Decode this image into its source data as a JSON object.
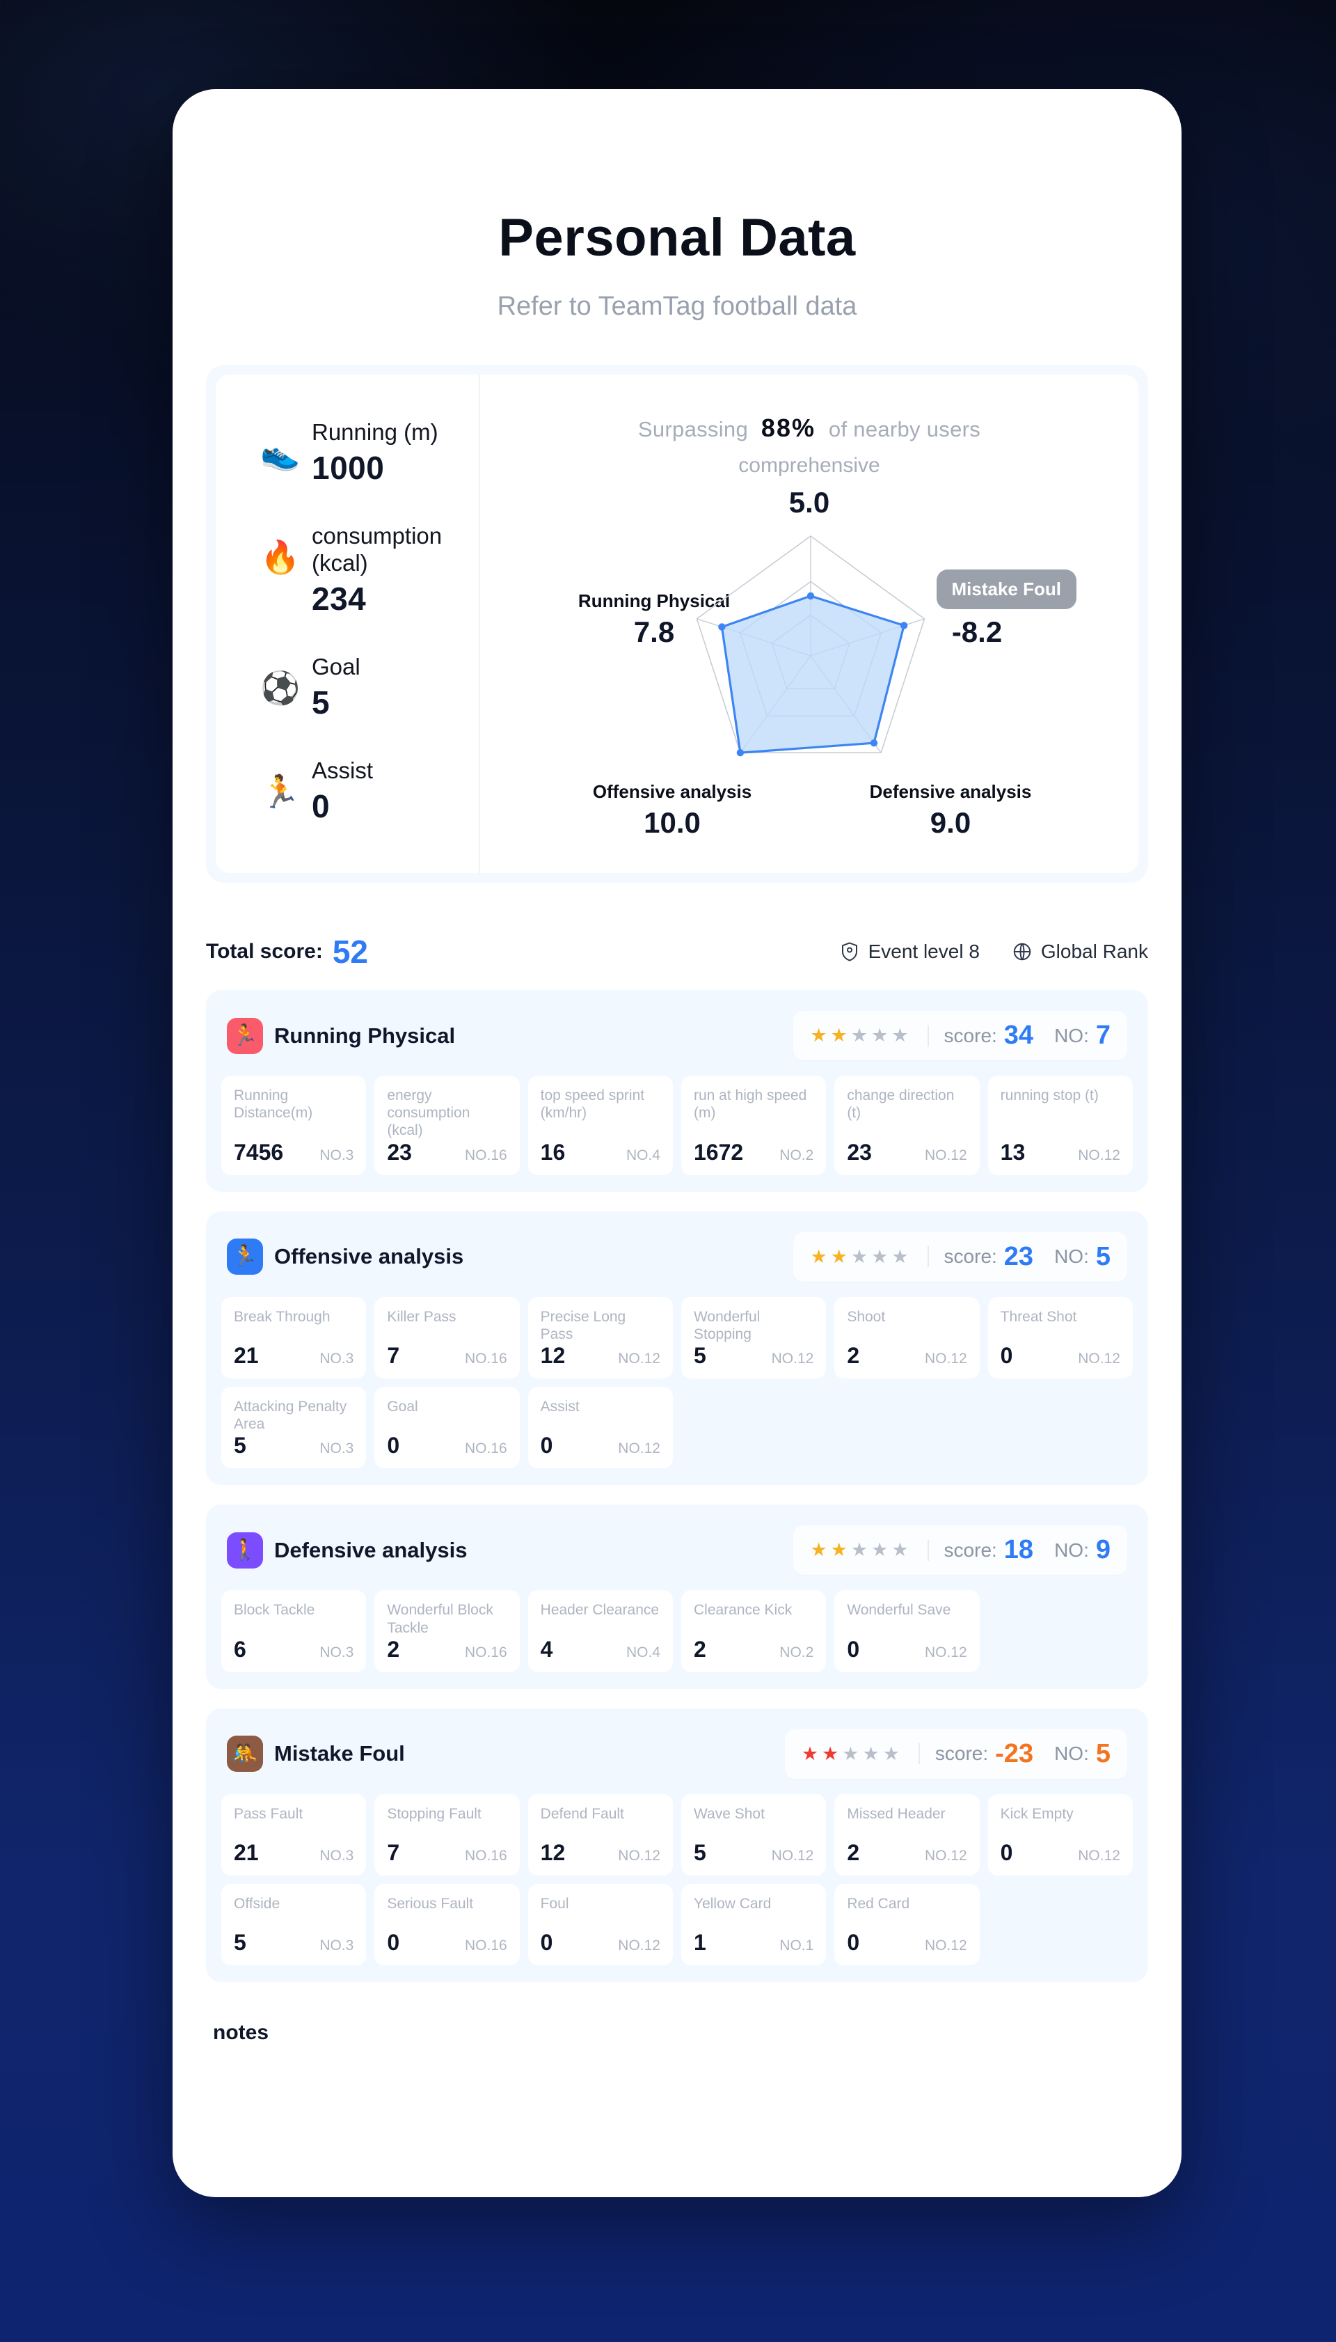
{
  "header": {
    "title": "Personal Data",
    "subtitle": "Refer to TeamTag football data"
  },
  "summary": {
    "stats": [
      {
        "icon": "running-shoe-icon",
        "glyph": "👟",
        "label": "Running (m)",
        "value": "1000"
      },
      {
        "icon": "flame-icon",
        "glyph": "🔥",
        "label": "consumption (kcal)",
        "value": "234"
      },
      {
        "icon": "soccer-ball-icon",
        "glyph": "⚽",
        "label": "Goal",
        "value": "5"
      },
      {
        "icon": "running-person-icon",
        "glyph": "🏃",
        "label": "Assist",
        "value": "0"
      }
    ],
    "surpassing": {
      "prefix": "Surpassing",
      "percent": "88%",
      "suffix": "of nearby users"
    }
  },
  "chart_data": {
    "type": "radar",
    "title": "",
    "max": 10,
    "axes": [
      "comprehensive",
      "Mistake  Foul",
      "Defensive analysis",
      "Offensive analysis",
      "Running  Physical"
    ],
    "values": [
      5.0,
      -8.2,
      9.0,
      10.0,
      7.8
    ],
    "labels": {
      "top": {
        "name": "comprehensive",
        "value": "5.0"
      },
      "right": {
        "name": "Mistake  Foul",
        "value": "-8.2",
        "highlighted": true
      },
      "bottom_right": {
        "name": "Defensive analysis",
        "value": "9.0"
      },
      "bottom_left": {
        "name": "Offensive analysis",
        "value": "10.0"
      },
      "left": {
        "name": "Running  Physical",
        "value": "7.8"
      }
    },
    "series": [
      {
        "name": "player",
        "values": [
          5.0,
          8.2,
          9.0,
          10.0,
          7.8
        ]
      }
    ],
    "grid": true,
    "legend": "none",
    "fill_color": "#bcd9fb",
    "line_color": "#3d85f2"
  },
  "total": {
    "label": "Total score:",
    "value": "52",
    "badges": [
      {
        "icon": "shield-icon",
        "label": "Event level 8"
      },
      {
        "icon": "globe-icon",
        "label": "Global Rank"
      }
    ]
  },
  "score_chip_labels": {
    "score": "score:",
    "no": "NO:"
  },
  "sections": [
    {
      "id": "running-physical",
      "title": "Running  Physical",
      "icon": "running-person-icon",
      "icon_glyph": "🏃",
      "icon_bg": "#fa5b6b",
      "stars_filled": 2,
      "stars_total": 5,
      "star_color": "#f5b324",
      "score": "34",
      "score_color": "#2f7bf6",
      "no": "7",
      "no_color": "#2f7bf6",
      "cells": [
        {
          "label": "Running Distance(m)",
          "value": "7456",
          "rank": "NO.3"
        },
        {
          "label": "energy consumption (kcal)",
          "value": "23",
          "rank": "NO.16"
        },
        {
          "label": "top speed sprint (km/hr)",
          "value": "16",
          "rank": "NO.4"
        },
        {
          "label": "run at high speed (m)",
          "value": "1672",
          "rank": "NO.2"
        },
        {
          "label": "change direction (t)",
          "value": "23",
          "rank": "NO.12"
        },
        {
          "label": "running stop (t)",
          "value": "13",
          "rank": "NO.12"
        }
      ]
    },
    {
      "id": "offensive-analysis",
      "title": "Offensive analysis",
      "icon": "running-person-icon",
      "icon_glyph": "🏃",
      "icon_bg": "#2f7bf6",
      "stars_filled": 2,
      "stars_total": 5,
      "star_color": "#f5b324",
      "score": "23",
      "score_color": "#2f7bf6",
      "no": "5",
      "no_color": "#2f7bf6",
      "cells": [
        {
          "label": "Break Through",
          "value": "21",
          "rank": "NO.3"
        },
        {
          "label": "Killer Pass",
          "value": "7",
          "rank": "NO.16"
        },
        {
          "label": "Precise Long Pass",
          "value": "12",
          "rank": "NO.12"
        },
        {
          "label": "Wonderful Stopping",
          "value": "5",
          "rank": "NO.12"
        },
        {
          "label": "Shoot",
          "value": "2",
          "rank": "NO.12"
        },
        {
          "label": "Threat Shot",
          "value": "0",
          "rank": "NO.12"
        },
        {
          "label": "Attacking Penalty Area",
          "value": "5",
          "rank": "NO.3"
        },
        {
          "label": "Goal",
          "value": "0",
          "rank": "NO.16"
        },
        {
          "label": "Assist",
          "value": "0",
          "rank": "NO.12"
        }
      ]
    },
    {
      "id": "defensive-analysis",
      "title": "Defensive analysis",
      "icon": "defender-icon",
      "icon_glyph": "🚶",
      "icon_bg": "#7c4dff",
      "stars_filled": 2,
      "stars_total": 5,
      "star_color": "#f5b324",
      "score": "18",
      "score_color": "#2f7bf6",
      "no": "9",
      "no_color": "#2f7bf6",
      "cells": [
        {
          "label": "Block Tackle",
          "value": "6",
          "rank": "NO.3"
        },
        {
          "label": "Wonderful Block Tackle",
          "value": "2",
          "rank": "NO.16"
        },
        {
          "label": "Header Clearance",
          "value": "4",
          "rank": "NO.4"
        },
        {
          "label": "Clearance Kick",
          "value": "2",
          "rank": "NO.2"
        },
        {
          "label": "Wonderful Save",
          "value": "0",
          "rank": "NO.12"
        }
      ]
    },
    {
      "id": "mistake-foul",
      "title": "Mistake  Foul",
      "icon": "foul-icon",
      "icon_glyph": "🤼",
      "icon_bg": "#8d5a43",
      "stars_filled": 2,
      "stars_total": 5,
      "star_color": "#ef3b2f",
      "score": "-23",
      "score_color": "#f4741e",
      "no": "5",
      "no_color": "#f4741e",
      "cells": [
        {
          "label": "Pass Fault",
          "value": "21",
          "rank": "NO.3"
        },
        {
          "label": "Stopping Fault",
          "value": "7",
          "rank": "NO.16"
        },
        {
          "label": "Defend Fault",
          "value": "12",
          "rank": "NO.12"
        },
        {
          "label": "Wave Shot",
          "value": "5",
          "rank": "NO.12"
        },
        {
          "label": "Missed Header",
          "value": "2",
          "rank": "NO.12"
        },
        {
          "label": "Kick Empty",
          "value": "0",
          "rank": "NO.12"
        },
        {
          "label": "Offside",
          "value": "5",
          "rank": "NO.3"
        },
        {
          "label": "Serious Fault",
          "value": "0",
          "rank": "NO.16"
        },
        {
          "label": "Foul",
          "value": "0",
          "rank": "NO.12"
        },
        {
          "label": "Yellow Card",
          "value": "1",
          "rank": "NO.1"
        },
        {
          "label": "Red Card",
          "value": "0",
          "rank": "NO.12"
        }
      ]
    }
  ],
  "notes": {
    "label": "notes"
  }
}
